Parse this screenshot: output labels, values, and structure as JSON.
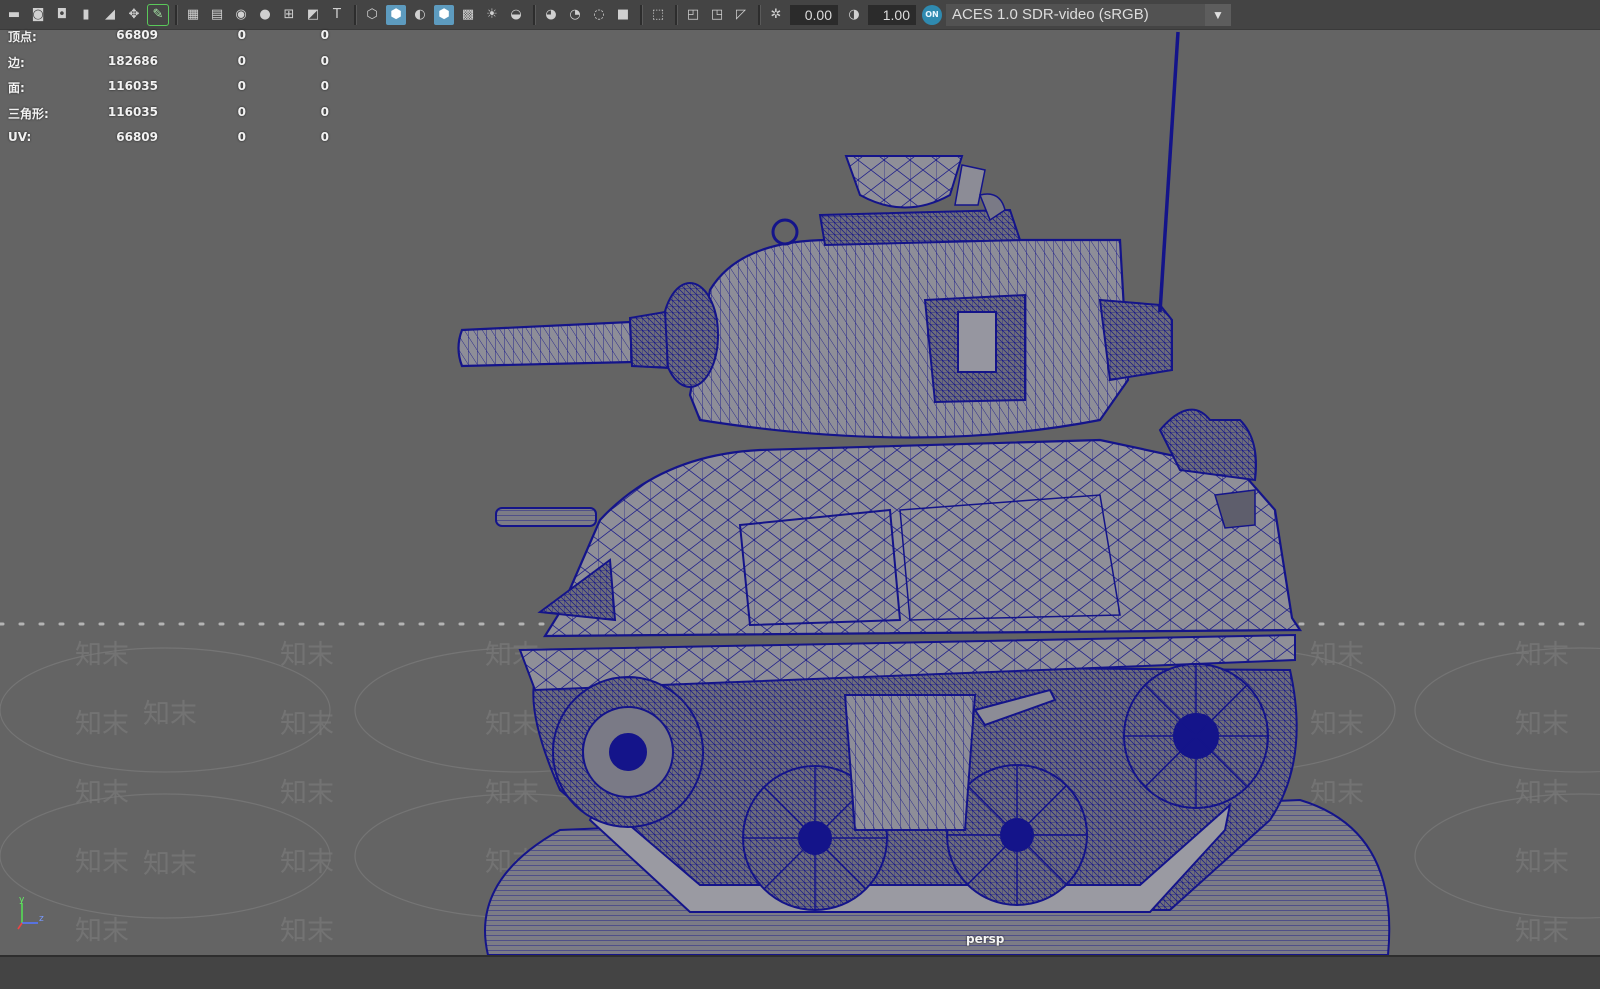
{
  "toolbar": {
    "exposure_value": "0.00",
    "gamma_value": "1.00",
    "color_mgmt_badge": "ON",
    "view_transform": "ACES 1.0 SDR-video (sRGB)",
    "icons": [
      "camera-select-icon",
      "camera-attributes-icon",
      "camera-bookmark-icon",
      "bookmark-icon",
      "image-plane-icon",
      "2d-pan-zoom-icon",
      "grease-pencil-icon",
      "grid-icon",
      "film-gate-icon",
      "resolution-gate-icon",
      "gate-mask-icon",
      "field-chart-icon",
      "safe-action-icon",
      "safe-title-icon",
      "wireframe-icon",
      "smooth-shade-icon",
      "default-material-icon",
      "wireframe-on-shaded-icon",
      "textured-icon",
      "use-all-lights-icon",
      "shadows-icon",
      "screen-space-ao-icon",
      "motion-blur-icon",
      "multisample-aa-icon",
      "depth-of-field-icon",
      "isolate-select-icon",
      "xray-icon",
      "xray-active-icon",
      "xray-joints-icon",
      "exposure-icon",
      "gamma-icon"
    ]
  },
  "hud": {
    "rows": [
      {
        "label": "顶点:",
        "value": "66809",
        "c2": "0",
        "c3": "0"
      },
      {
        "label": "边:",
        "value": "182686",
        "c2": "0",
        "c3": "0"
      },
      {
        "label": "面:",
        "value": "116035",
        "c2": "0",
        "c3": "0"
      },
      {
        "label": "三角形:",
        "value": "116035",
        "c2": "0",
        "c3": "0"
      },
      {
        "label": "UV:",
        "value": "66809",
        "c2": "0",
        "c3": "0"
      }
    ]
  },
  "viewport": {
    "camera_label": "persp",
    "watermark_text": "知末",
    "axis_label_y": "y",
    "axis_label_z": "z",
    "wire_color": "#14148a",
    "shade_color": "#8c8c96",
    "background_color": "#646464"
  }
}
